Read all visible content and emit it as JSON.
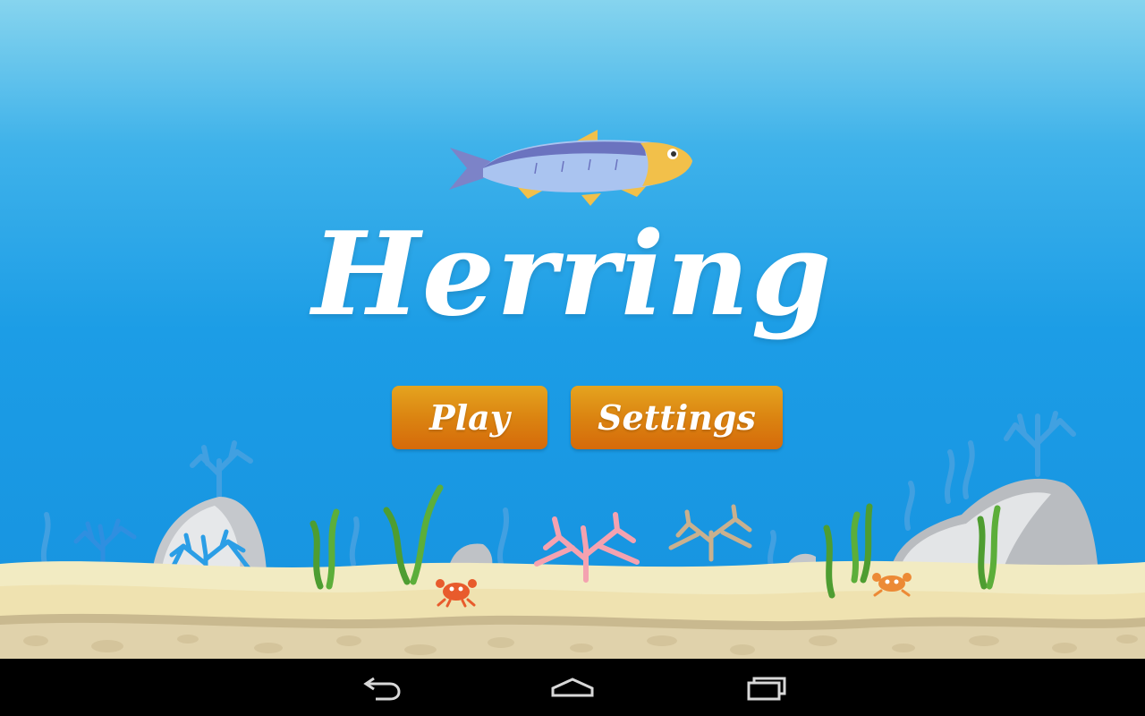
{
  "game": {
    "title": "Herring",
    "menu": {
      "play_label": "Play",
      "settings_label": "Settings"
    }
  },
  "navigation_bar": {
    "buttons": [
      {
        "name": "back",
        "icon": "back-arrow-icon"
      },
      {
        "name": "home",
        "icon": "home-icon"
      },
      {
        "name": "recents",
        "icon": "recent-apps-icon"
      }
    ]
  },
  "colors": {
    "sky_top": "#86d4ee",
    "water": "#1c9de6",
    "button_top": "#e5a41f",
    "button_bottom": "#d56a0a",
    "sand": "#f0e6b4",
    "bedrock": "#d8c9a2",
    "navbar": "#000000"
  }
}
